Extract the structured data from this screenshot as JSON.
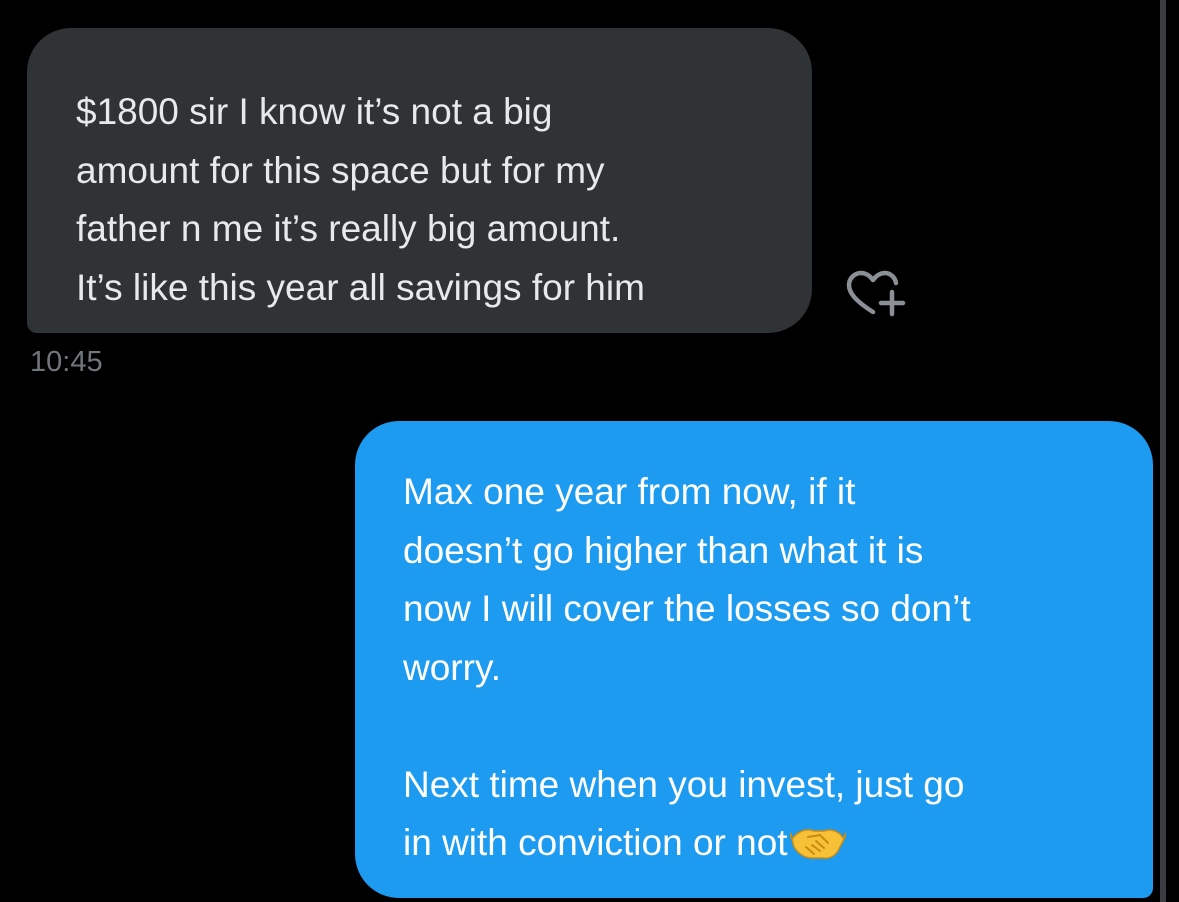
{
  "conversation": {
    "received_message": {
      "text": "$1800 sir I know it’s not a big\namount for this space but for my\nfather n me it’s really big amount.\nIt’s like this year all savings for him",
      "timestamp": "10:45",
      "react_icon": "heart-plus-icon"
    },
    "sent_message": {
      "paragraph_1": "Max one year from now, if it\ndoesn’t go higher than what it is\nnow I will cover the losses so don’t\nworry.",
      "paragraph_2": "Next time when you invest, just go\nin with conviction or not",
      "emoji_icon": "handshake-icon"
    }
  },
  "colors": {
    "background": "#000000",
    "received_bubble": "#2f3336",
    "received_text": "#e7e9ea",
    "sent_bubble": "#1d9bf0",
    "sent_text": "#ffffff",
    "timestamp": "#71767b",
    "scrollbar": "#3a3d41"
  }
}
